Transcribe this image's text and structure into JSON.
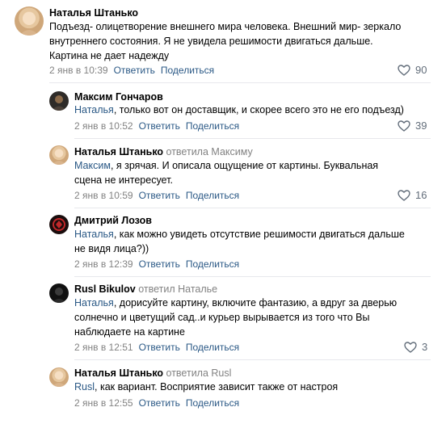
{
  "comments": [
    {
      "author": "Наталья Штанько",
      "replied_to": "",
      "mention": "",
      "text": "Подъезд- олицетворение внешнего мира человека. Внешний мир- зеркало\nвнутреннего состояния. Я не увидела решимости двигаться дальше.\nКартина не дает надежду",
      "date": "2 янв в 10:39",
      "reply_label": "Ответить",
      "share_label": "Поделиться",
      "likes": "90",
      "avatar_icon": "avatar-photo-woman"
    },
    {
      "author": "Максим Гончаров",
      "replied_to": "",
      "mention": "Наталья",
      "text": ", только вот он доставщик, и скорее всего это не его подъезд)",
      "date": "2 янв в 10:52",
      "reply_label": "Ответить",
      "share_label": "Поделиться",
      "likes": "39",
      "avatar_icon": "avatar-photo-man"
    },
    {
      "author": "Наталья Штанько",
      "replied_to": "ответила Максиму",
      "mention": "Максим",
      "text": ", я зрячая. И описала ощущение от картины. Буквальная\nсцена не интересует.",
      "date": "2 янв в 10:59",
      "reply_label": "Ответить",
      "share_label": "Поделиться",
      "likes": "16",
      "avatar_icon": "avatar-photo-woman"
    },
    {
      "author": "Дмитрий Лозов",
      "replied_to": "",
      "mention": "Наталья",
      "text": ", как можно увидеть отсутствие решимости двигаться дальше\nне видя лица?))",
      "date": "2 янв в 12:39",
      "reply_label": "Ответить",
      "share_label": "Поделиться",
      "likes": "",
      "avatar_icon": "avatar-logo-red"
    },
    {
      "author": "Rusl Bikulov",
      "replied_to": "ответил Наталье",
      "mention": "Наталья",
      "text": ", дорисуйте картину, включите фантазию, а вдруг за дверью\nсолнечно и цветущий сад..и курьер вырывается из того что Вы\nнаблюдаете на картине",
      "date": "2 янв в 12:51",
      "reply_label": "Ответить",
      "share_label": "Поделиться",
      "likes": "3",
      "avatar_icon": "avatar-photo-dark"
    },
    {
      "author": "Наталья Штанько",
      "replied_to": "ответила Rusl",
      "mention": "Rusl",
      "text": ", как вариант. Восприятие зависит также от настроя",
      "date": "2 янв в 12:55",
      "reply_label": "Ответить",
      "share_label": "Поделиться",
      "likes": "",
      "avatar_icon": "avatar-photo-woman"
    }
  ],
  "colors": {
    "link": "#2a5885",
    "meta": "#828282",
    "divider": "#e7e8ec",
    "like_icon": "#626d7a"
  }
}
